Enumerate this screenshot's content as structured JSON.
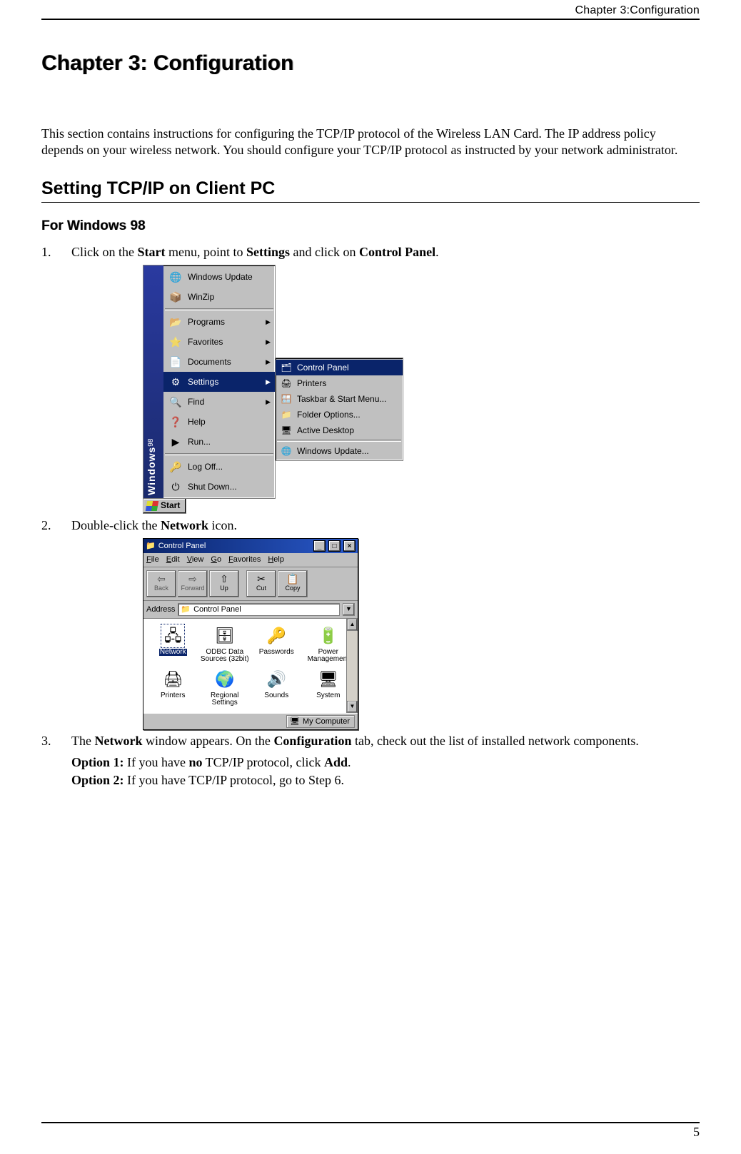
{
  "header": {
    "running": "Chapter 3:Configuration"
  },
  "chapter": {
    "title": "Chapter 3: Configuration"
  },
  "intro": "This section contains instructions for configuring the TCP/IP protocol of the Wireless LAN Card. The IP address policy depends on your wireless network. You should configure your TCP/IP protocol as instructed by your network administrator.",
  "h2": "Setting TCP/IP on Client PC",
  "h3": "For Windows 98",
  "steps": {
    "s1_pre": "Click on the ",
    "s1_b1": "Start",
    "s1_mid1": " menu, point to ",
    "s1_b2": "Settings",
    "s1_mid2": " and click on ",
    "s1_b3": "Control Panel",
    "s1_post": ".",
    "s2_pre": "Double-click the ",
    "s2_b1": "Network",
    "s2_post": " icon.",
    "s3_pre": "The ",
    "s3_b1": "Network",
    "s3_mid1": " window appears. On the ",
    "s3_b2": "Configuration",
    "s3_post": " tab, check out the list of installed network components.",
    "opt1_label": "Option 1:",
    "opt1_pre": " If you have ",
    "opt1_b1": "no",
    "opt1_mid": " TCP/IP protocol, click ",
    "opt1_b2": "Add",
    "opt1_post": ".",
    "opt2_label": "Option 2:",
    "opt2_text": " If you have TCP/IP protocol, go to Step 6."
  },
  "startmenu": {
    "banner": "Windows",
    "banner_sub": "98",
    "items": [
      {
        "label": "Windows Update",
        "arrow": false
      },
      {
        "label": "WinZip",
        "arrow": false
      },
      {
        "label": "Programs",
        "arrow": true
      },
      {
        "label": "Favorites",
        "arrow": true
      },
      {
        "label": "Documents",
        "arrow": true
      },
      {
        "label": "Settings",
        "arrow": true,
        "hl": true
      },
      {
        "label": "Find",
        "arrow": true
      },
      {
        "label": "Help",
        "arrow": false
      },
      {
        "label": "Run...",
        "arrow": false
      },
      {
        "label": "Log Off...",
        "arrow": false
      },
      {
        "label": "Shut Down...",
        "arrow": false
      }
    ],
    "sub": [
      {
        "label": "Control Panel",
        "hl": true
      },
      {
        "label": "Printers"
      },
      {
        "label": "Taskbar & Start Menu..."
      },
      {
        "label": "Folder Options..."
      },
      {
        "label": "Active Desktop"
      },
      {
        "label": "Windows Update..."
      }
    ],
    "start_button": "Start"
  },
  "cp": {
    "title": "Control Panel",
    "menus": [
      "File",
      "Edit",
      "View",
      "Go",
      "Favorites",
      "Help"
    ],
    "toolbar": [
      {
        "label": "Back",
        "enabled": false
      },
      {
        "label": "Forward",
        "enabled": false
      },
      {
        "label": "Up",
        "enabled": true
      },
      {
        "label": "Cut",
        "enabled": true
      },
      {
        "label": "Copy",
        "enabled": true
      }
    ],
    "address_label": "Address",
    "address_value": "Control Panel",
    "icons": [
      {
        "label": "Network",
        "selected": true
      },
      {
        "label": "ODBC Data Sources (32bit)"
      },
      {
        "label": "Passwords"
      },
      {
        "label": "Power Management"
      },
      {
        "label": "Printers"
      },
      {
        "label": "Regional Settings"
      },
      {
        "label": "Sounds"
      },
      {
        "label": "System"
      }
    ],
    "status": "My Computer"
  },
  "page_number": "5"
}
